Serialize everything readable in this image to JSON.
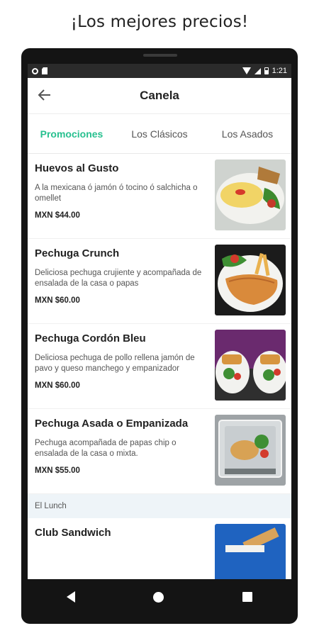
{
  "headline": "¡Los mejores precios!",
  "status": {
    "time": "1:21"
  },
  "appbar": {
    "title": "Canela"
  },
  "tabs": [
    {
      "label": "Promociones",
      "active": true
    },
    {
      "label": "Los Clásicos",
      "active": false
    },
    {
      "label": "Los Asados",
      "active": false
    }
  ],
  "items": [
    {
      "name": "Huevos al Gusto",
      "description": "A la mexicana ó jamón ó tocino ó salchicha o omellet",
      "price": "MXN $44.00"
    },
    {
      "name": "Pechuga Crunch",
      "description": "Deliciosa pechuga crujiente y acompañada de ensalada de la casa o papas",
      "price": "MXN $60.00"
    },
    {
      "name": "Pechuga Cordón Bleu",
      "description": "Deliciosa pechuga de pollo rellena jamón de pavo y queso manchego y empanizador",
      "price": "MXN $60.00"
    },
    {
      "name": "Pechuga Asada o Empanizada",
      "description": "Pechuga acompañada de papas chip o ensalada de la casa o mixta.",
      "price": "MXN $55.00"
    }
  ],
  "section": {
    "label": "El Lunch"
  },
  "next_item": {
    "name": "Club Sandwich"
  },
  "colors": {
    "accent": "#27c08f",
    "status_bar": "#2b2b2b",
    "section_bg": "#eef4f8"
  },
  "icons": [
    "back-arrow-icon",
    "wifi-icon",
    "signal-icon",
    "battery-icon",
    "nav-back-icon",
    "nav-home-icon",
    "nav-recents-icon"
  ]
}
